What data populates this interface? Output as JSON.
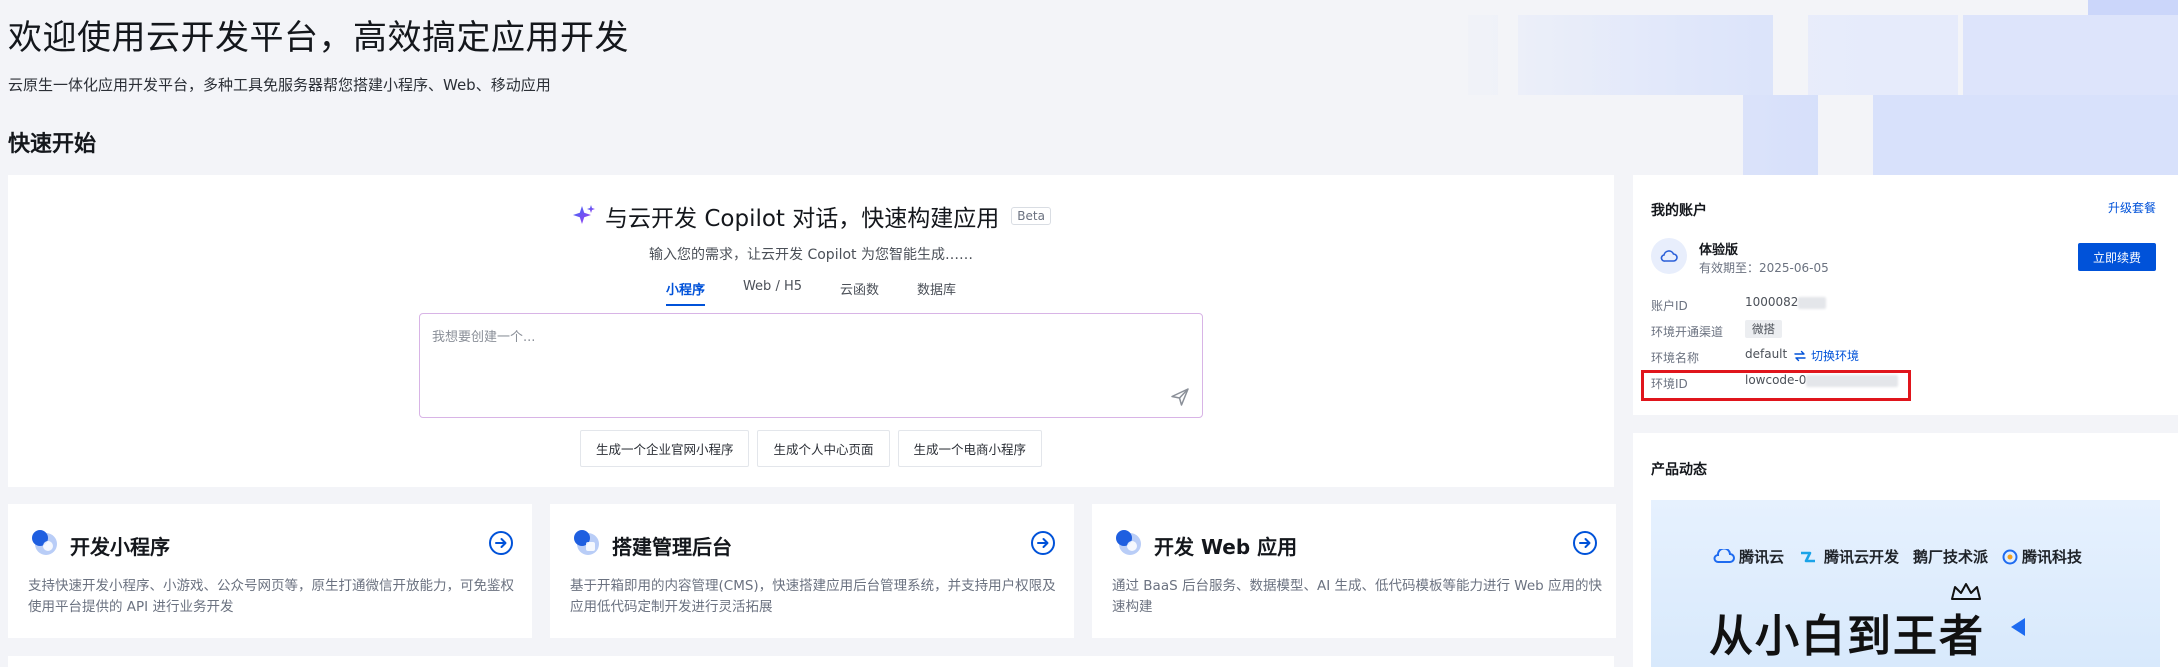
{
  "hero": {
    "title": "欢迎使用云开发平台，高效搞定应用开发",
    "subtitle": "云原生一体化应用开发平台，多种工具免服务器帮您搭建小程序、Web、移动应用"
  },
  "quick_start": {
    "title": "快速开始"
  },
  "copilot": {
    "title": "与云开发 Copilot 对话，快速构建应用",
    "badge": "Beta",
    "description": "输入您的需求，让云开发 Copilot 为您智能生成……",
    "tabs": [
      {
        "label": "小程序",
        "active": true
      },
      {
        "label": "Web / H5",
        "active": false
      },
      {
        "label": "云函数",
        "active": false
      },
      {
        "label": "数据库",
        "active": false
      }
    ],
    "input_placeholder": "我想要创建一个...",
    "suggestions": [
      "生成一个企业官网小程序",
      "生成个人中心页面",
      "生成一个电商小程序"
    ]
  },
  "features": [
    {
      "title": "开发小程序",
      "description": "支持快速开发小程序、小游戏、公众号网页等，原生打通微信开放能力，可免鉴权使用平台提供的 API 进行业务开发"
    },
    {
      "title": "搭建管理后台",
      "description": "基于开箱即用的内容管理(CMS)，快速搭建应用后台管理系统，并支持用户权限及应用低代码定制开发进行灵活拓展"
    },
    {
      "title": "开发 Web 应用",
      "description": "通过 BaaS 后台服务、数据模型、AI 生成、低代码模板等能力进行 Web 应用的快速构建"
    }
  ],
  "account": {
    "title": "我的账户",
    "upgrade_label": "升级套餐",
    "plan_name": "体验版",
    "plan_expiry": "有效期至：2025-06-05",
    "renew_label": "立即续费",
    "fields": {
      "account_id_label": "账户ID",
      "account_id_value": "1000082",
      "channel_label": "环境开通渠道",
      "channel_value": "微搭",
      "env_name_label": "环境名称",
      "env_name_value": "default",
      "switch_env_label": "切换环境",
      "env_id_label": "环境ID",
      "env_id_value": "lowcode-0"
    }
  },
  "news": {
    "title": "产品动态",
    "banner": {
      "brands": [
        "腾讯云",
        "腾讯云开发",
        "鹅厂技术派",
        "腾讯科技"
      ],
      "slogan": "从小白到王者"
    }
  },
  "colors": {
    "primary": "#0052d9",
    "highlight": "#e0151c",
    "page_bg": "#f3f4f8"
  }
}
